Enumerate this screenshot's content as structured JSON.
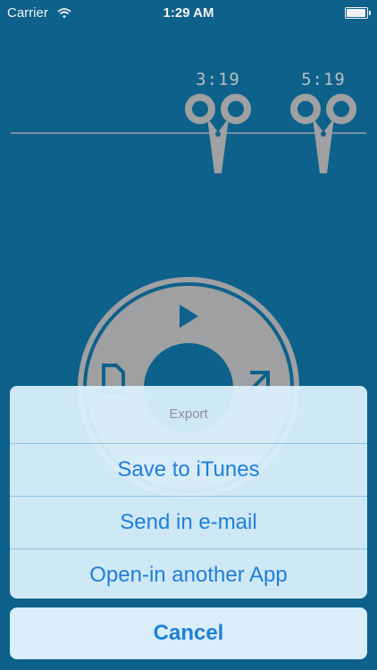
{
  "status_bar": {
    "carrier": "Carrier",
    "time": "1:29 AM"
  },
  "timeline": {
    "cut_start": "3:19",
    "cut_end": "5:19"
  },
  "action_sheet": {
    "title": "Export",
    "options": [
      {
        "label": "Save to iTunes"
      },
      {
        "label": "Send in e-mail"
      },
      {
        "label": "Open-in another App"
      }
    ],
    "cancel_label": "Cancel"
  },
  "colors": {
    "background": "#0e6792",
    "control_gray": "#a7a9ab",
    "action_blue": "#1f7fd9"
  },
  "icons": [
    "wifi-icon",
    "battery-icon",
    "scissors-icon",
    "play-icon",
    "file-icon",
    "export-icon"
  ]
}
